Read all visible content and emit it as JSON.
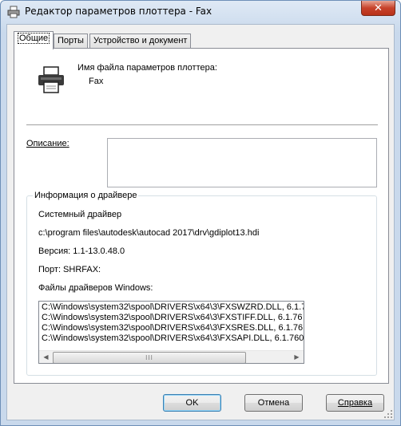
{
  "window": {
    "title": "Редактор параметров плоттера - Fax",
    "close_glyph": "✕"
  },
  "tabs": [
    {
      "label": "Общие",
      "active": true
    },
    {
      "label": "Порты",
      "active": false
    },
    {
      "label": "Устройство и документ",
      "active": false
    }
  ],
  "general": {
    "file_name_label": "Имя файла параметров плоттера:",
    "file_name_value": "Fax",
    "description_label": "Описание:",
    "description_value": ""
  },
  "driver_info": {
    "group_title": "Информация о драйвере",
    "driver_type": "Системный драйвер",
    "driver_path": "c:\\program files\\autodesk\\autocad 2017\\drv\\gdiplot13.hdi",
    "version": "Версия: 1.1-13.0.48.0",
    "port": "Порт: SHRFAX:",
    "windows_files_label": "Файлы драйверов Windows:",
    "files": [
      "C:\\Windows\\system32\\spool\\DRIVERS\\x64\\3\\FXSWZRD.DLL, 6.1.7",
      "C:\\Windows\\system32\\spool\\DRIVERS\\x64\\3\\FXSTIFF.DLL, 6.1.76",
      "C:\\Windows\\system32\\spool\\DRIVERS\\x64\\3\\FXSRES.DLL, 6.1.76",
      "C:\\Windows\\system32\\spool\\DRIVERS\\x64\\3\\FXSAPI.DLL, 6.1.760"
    ],
    "thumb_grip": "III"
  },
  "buttons": {
    "ok": "OK",
    "cancel": "Отмена",
    "help": "Справка"
  }
}
